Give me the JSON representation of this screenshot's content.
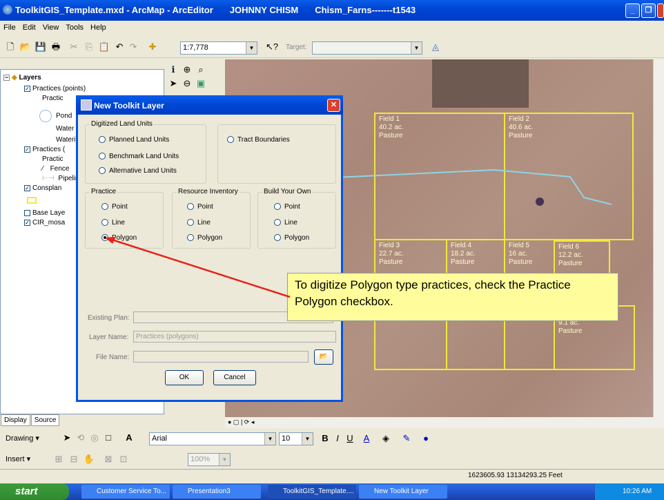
{
  "window": {
    "title": "ToolkitGIS_Template.mxd - ArcMap - ArcEditor",
    "user": "JOHNNY CHISM",
    "project": "Chism_Farns-------t1543"
  },
  "menu": [
    "File",
    "Edit",
    "View",
    "Tools",
    "Help"
  ],
  "toolbar": {
    "scale": "1:7,778",
    "target_label": "Target:"
  },
  "toc": {
    "root": "Layers",
    "items": [
      "Practices (points)",
      "Practic",
      "Pond",
      "Water",
      "Wateri",
      "Practices (",
      "Practic",
      "Fence",
      "Pipelin",
      "Consplan",
      "Base Laye",
      "CIR_mosa"
    ],
    "tabs": [
      "Display",
      "Source"
    ]
  },
  "map_fields": [
    {
      "name": "Field 1",
      "acres": "40.2 ac.",
      "use": "Pasture"
    },
    {
      "name": "Field 2",
      "acres": "40.6 ac.",
      "use": "Pasture"
    },
    {
      "name": "Field 3",
      "acres": "22.7 ac.",
      "use": "Pasture"
    },
    {
      "name": "Field 4",
      "acres": "18.2 ac.",
      "use": "Pasture"
    },
    {
      "name": "Field 5",
      "acres": "16 ac.",
      "use": "Pasture"
    },
    {
      "name": "Field 6",
      "acres": "12.2 ac.",
      "use": "Pasture"
    },
    {
      "name": "",
      "acres": "9.1 ac.",
      "use": "Pasture"
    }
  ],
  "dialog": {
    "title": "New Toolkit Layer",
    "digitized_group": "Digitized Land Units",
    "planned": "Planned Land Units",
    "benchmark": "Benchmark Land Units",
    "alternative": "Alternative Land Units",
    "tract": "Tract Boundaries",
    "practice_group": "Practice",
    "resource_group": "Resource Inventory",
    "build_group": "Build Your Own",
    "point": "Point",
    "line": "Line",
    "polygon": "Polygon",
    "existing_plan_label": "Existing Plan:",
    "layer_name_label": "Layer Name:",
    "layer_name_value": "Practices (polygons)",
    "file_name_label": "File Name:",
    "ok": "OK",
    "cancel": "Cancel"
  },
  "callout": "To digitize Polygon type practices, check the Practice Polygon checkbox.",
  "drawing": {
    "drawing_label": "Drawing",
    "font": "Arial",
    "size": "10",
    "bold": "B",
    "italic": "I",
    "underline": "U"
  },
  "insert": {
    "insert_label": "Insert",
    "zoom": "100%"
  },
  "status": {
    "coords": "1623605.93  13134293.25 Feet"
  },
  "taskbar": {
    "start": "start",
    "tasks": [
      "Customer Service To...",
      "Presentation3",
      "ToolkitGIS_Template....",
      "New Toolkit Layer"
    ],
    "time": "10:26 AM"
  },
  "colors": {
    "field_border": "#f4e83a",
    "callout_bg": "#fffc9b",
    "arrow": "#e8221c"
  }
}
